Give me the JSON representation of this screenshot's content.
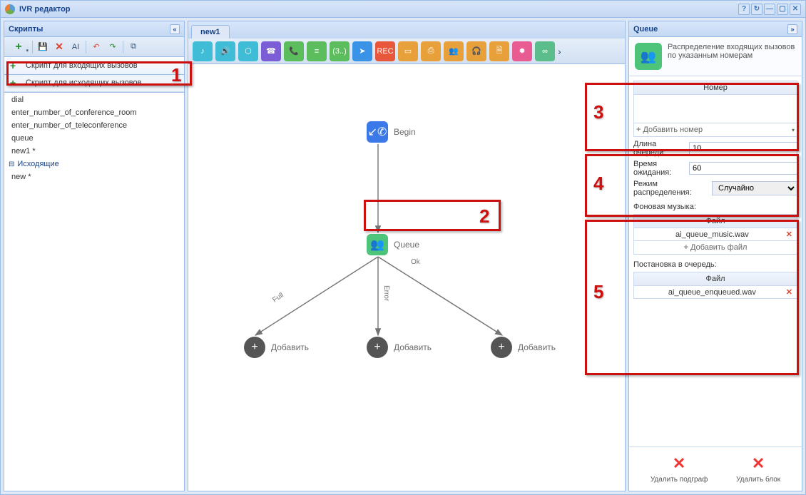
{
  "title": "IVR редактор",
  "left": {
    "title": "Скрипты",
    "menu_incoming": "Скрипт для входящих вызовов",
    "menu_outgoing": "Скрипт для исходящих вызовов",
    "scripts": [
      "dial",
      "enter_number_of_conference_room",
      "enter_number_of_teleconference",
      "queue",
      "new1 *"
    ],
    "outgoing_hdr": "Исходящие",
    "outgoing_items": [
      "new *"
    ]
  },
  "center": {
    "tab": "new1",
    "begin": "Begin",
    "queue": "Queue",
    "add": "Добавить",
    "edge_full": "Full",
    "edge_error": "Error",
    "edge_ok": "Ok"
  },
  "right": {
    "title": "Queue",
    "desc": "Распределение входящих вызовов по указанным номерам",
    "number_hdr": "Номер",
    "add_number": "Добавить номер",
    "qlen_label": "Длина очереди:",
    "qlen_val": "10",
    "wait_label": "Время ожидания:",
    "wait_val": "60",
    "mode_label": "Режим распределения:",
    "mode_val": "Случайно",
    "bgmusic": "Фоновая музыка:",
    "file_hdr": "Файл",
    "music_file": "ai_queue_music.wav",
    "add_file": "Добавить файл",
    "enqueue": "Постановка в очередь:",
    "enqueue_file": "ai_queue_enqueued.wav",
    "del_sub": "Удалить подграф",
    "del_block": "Удалить блок"
  },
  "palette_colors": [
    "#3fbdd6",
    "#3fbdd6",
    "#3fbdd6",
    "#7b5dd6",
    "#5bbd5b",
    "#5bbd5b",
    "#5bbd5b",
    "#3b93e8",
    "#e8573b",
    "#e8a03b",
    "#e8a03b",
    "#e8a03b",
    "#e8a03b",
    "#e8a03b",
    "#e85b93",
    "#5bbd8b"
  ],
  "palette_glyphs": [
    "♪",
    "🔊",
    "⬡",
    "☎",
    "📞",
    "≡",
    "(3..)",
    "➤",
    "REC",
    "▭",
    "⎙",
    "👥",
    "🎧",
    "🗎",
    "✹",
    "∞"
  ]
}
